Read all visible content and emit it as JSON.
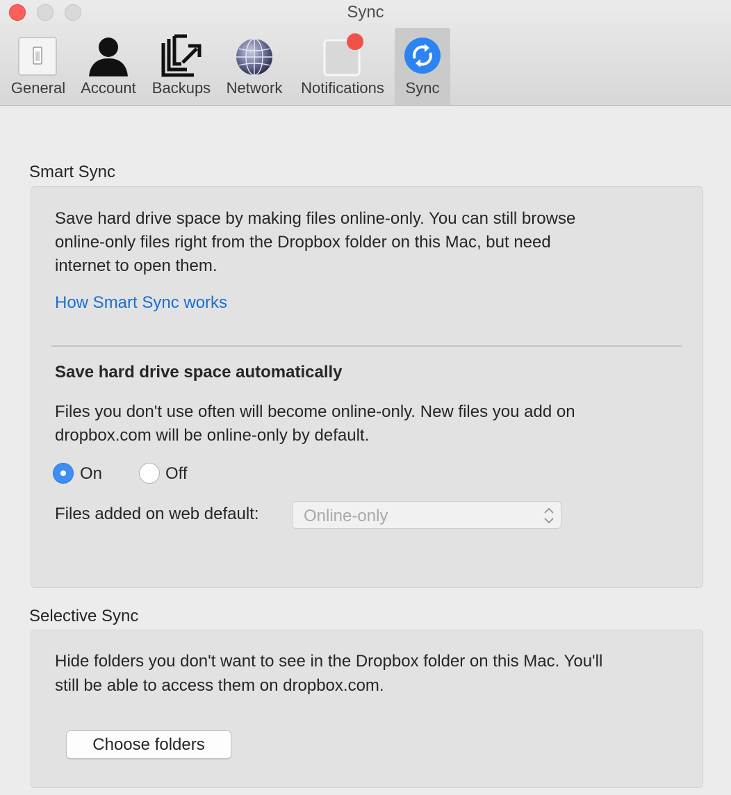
{
  "window": {
    "title": "Sync"
  },
  "tabs": [
    {
      "label": "General",
      "icon": "light-switch-icon"
    },
    {
      "label": "Account",
      "icon": "person-icon"
    },
    {
      "label": "Backups",
      "icon": "backup-upload-icon"
    },
    {
      "label": "Network",
      "icon": "globe-icon"
    },
    {
      "label": "Notifications",
      "icon": "notification-badge-icon"
    },
    {
      "label": "Sync",
      "icon": "sync-arrows-icon",
      "active": true
    }
  ],
  "smart_sync": {
    "heading": "Smart Sync",
    "description_line1": "Save hard drive space by making files online-only. You can still browse",
    "description_line2": "online-only files right from the Dropbox folder on this Mac, but need",
    "description_line3": "internet to open them.",
    "link": "How Smart Sync works",
    "auto_heading": "Save hard drive space automatically",
    "auto_line1": "Files you don't use often will become online-only. New files you add on",
    "auto_line2": "dropbox.com will be online-only by default.",
    "radio_on": "On",
    "radio_off": "Off",
    "selected": "On",
    "web_default_label": "Files added on web default:",
    "web_default_value": "Online-only"
  },
  "selective_sync": {
    "heading": "Selective Sync",
    "line1": "Hide folders you don't want to see in the Dropbox folder on this Mac. You'll",
    "line2": "still be able to access them on dropbox.com.",
    "button": "Choose folders"
  },
  "colors": {
    "accent": "#3d8ef5",
    "link": "#1a6fd0",
    "close": "#fc605c",
    "badge": "#f0524a"
  }
}
